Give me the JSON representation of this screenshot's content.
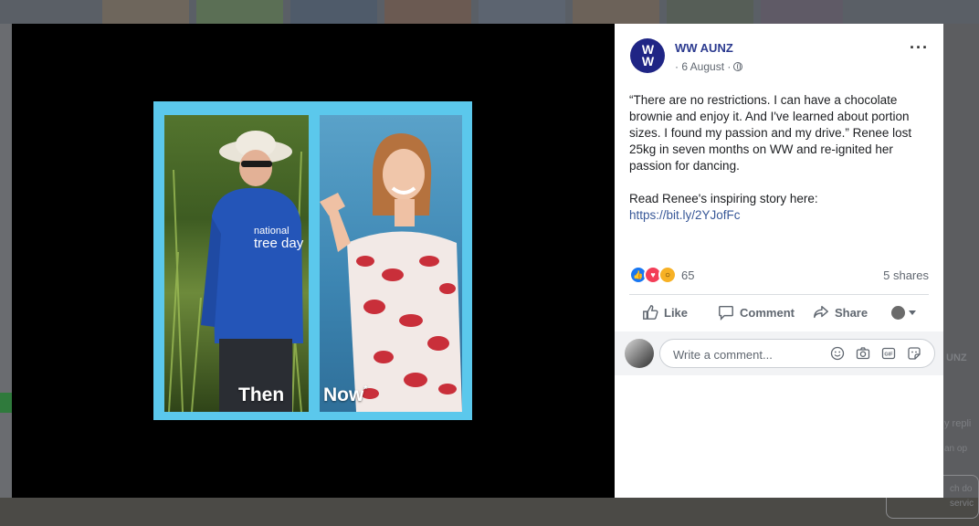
{
  "background": {
    "right_fragments": [
      "UNZ",
      "y repli",
      "an op",
      "ch do",
      "servic"
    ]
  },
  "image": {
    "label_then": "Then",
    "label_now": "Now",
    "label_now_mark": "*"
  },
  "post": {
    "page_name": "WW AUNZ",
    "avatar_initials_top": "W",
    "avatar_initials_bottom": "W",
    "date": "· 6 August ·",
    "more_label": "···",
    "text_paragraph_1": "“There are no restrictions. I can have a chocolate brownie and enjoy it. And I've learned about portion sizes. I found my passion and my drive.” Renee lost 25kg in seven months on WW and re-ignited her passion for dancing.",
    "text_paragraph_2": "Read Renee's inspiring story here:",
    "link": "https://bit.ly/2YJofFc",
    "reaction_count": "65",
    "shares": "5 shares",
    "actions": {
      "like": "Like",
      "comment": "Comment",
      "share": "Share"
    },
    "comment_placeholder": "Write a comment..."
  },
  "colors": {
    "page_name": "#2b3a8f",
    "link": "#385898",
    "frame": "#5bc8ec",
    "avatar_bg": "#1f2585"
  },
  "icons": [
    "globe-icon",
    "more-options-icon",
    "like-reaction-icon",
    "love-reaction-icon",
    "wow-reaction-icon",
    "like-icon",
    "comment-icon",
    "share-icon",
    "chevron-down-icon",
    "emoji-icon",
    "camera-icon",
    "gif-icon",
    "sticker-icon"
  ]
}
